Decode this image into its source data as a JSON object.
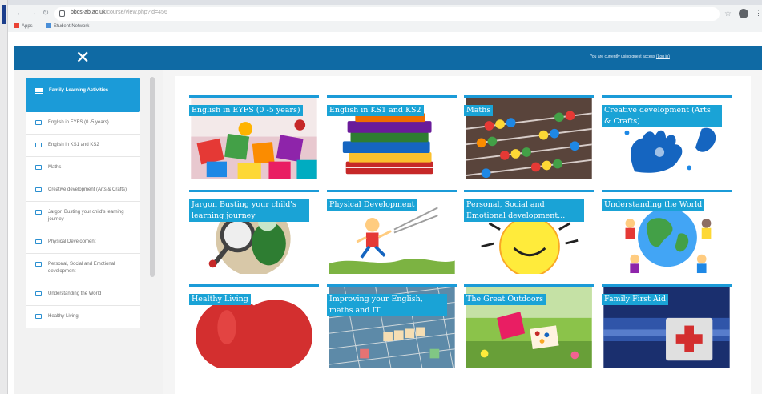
{
  "browser": {
    "url_host": "bbcs-ab.ac.uk",
    "url_path": "/course/view.php?id=456",
    "bookmarks": [
      {
        "label": "Apps"
      },
      {
        "label": "Student Network"
      }
    ]
  },
  "header": {
    "close_icon": "close-icon",
    "guest_text": "You are currently using guest access",
    "guest_link": "(Log in)"
  },
  "drawer": {
    "active_label": "Family Learning Activities",
    "items": [
      {
        "label": "English in EYFS (0 -5 years)"
      },
      {
        "label": "English in KS1 and KS2"
      },
      {
        "label": "Maths"
      },
      {
        "label": "Creative development (Arts & Crafts)"
      },
      {
        "label": "Jargon Busting your child's learning journey"
      },
      {
        "label": "Physical Development"
      },
      {
        "label": "Personal, Social and Emotional development"
      },
      {
        "label": "Understanding the World"
      },
      {
        "label": "Healthy Living"
      }
    ]
  },
  "tiles": [
    {
      "title": "English in EYFS (0 -5 years)",
      "icon": "abc-letters-image"
    },
    {
      "title": "English in KS1 and KS2",
      "icon": "books-image"
    },
    {
      "title": "Maths",
      "icon": "abacus-image"
    },
    {
      "title": "Creative development (Arts & Crafts)",
      "icon": "painted-hand-image"
    },
    {
      "title": "Jargon Busting your child's learning journey",
      "icon": "magnifier-image"
    },
    {
      "title": "Physical Development",
      "icon": "running-child-image"
    },
    {
      "title": "Personal, Social and Emotional development...",
      "icon": "sun-image"
    },
    {
      "title": "Understanding the World",
      "icon": "globe-image"
    },
    {
      "title": "Healthy Living",
      "icon": "apple-image"
    },
    {
      "title": "Improving your English, maths and IT",
      "icon": "scrabble-image"
    },
    {
      "title": "The Great Outdoors",
      "icon": "garden-image"
    },
    {
      "title": "Family First Aid",
      "icon": "first-aid-kit-image"
    }
  ],
  "colors": {
    "header_bg": "#0f6aa4",
    "accent": "#1b9bd8",
    "tile_title_bg": "#1aa3d6"
  }
}
